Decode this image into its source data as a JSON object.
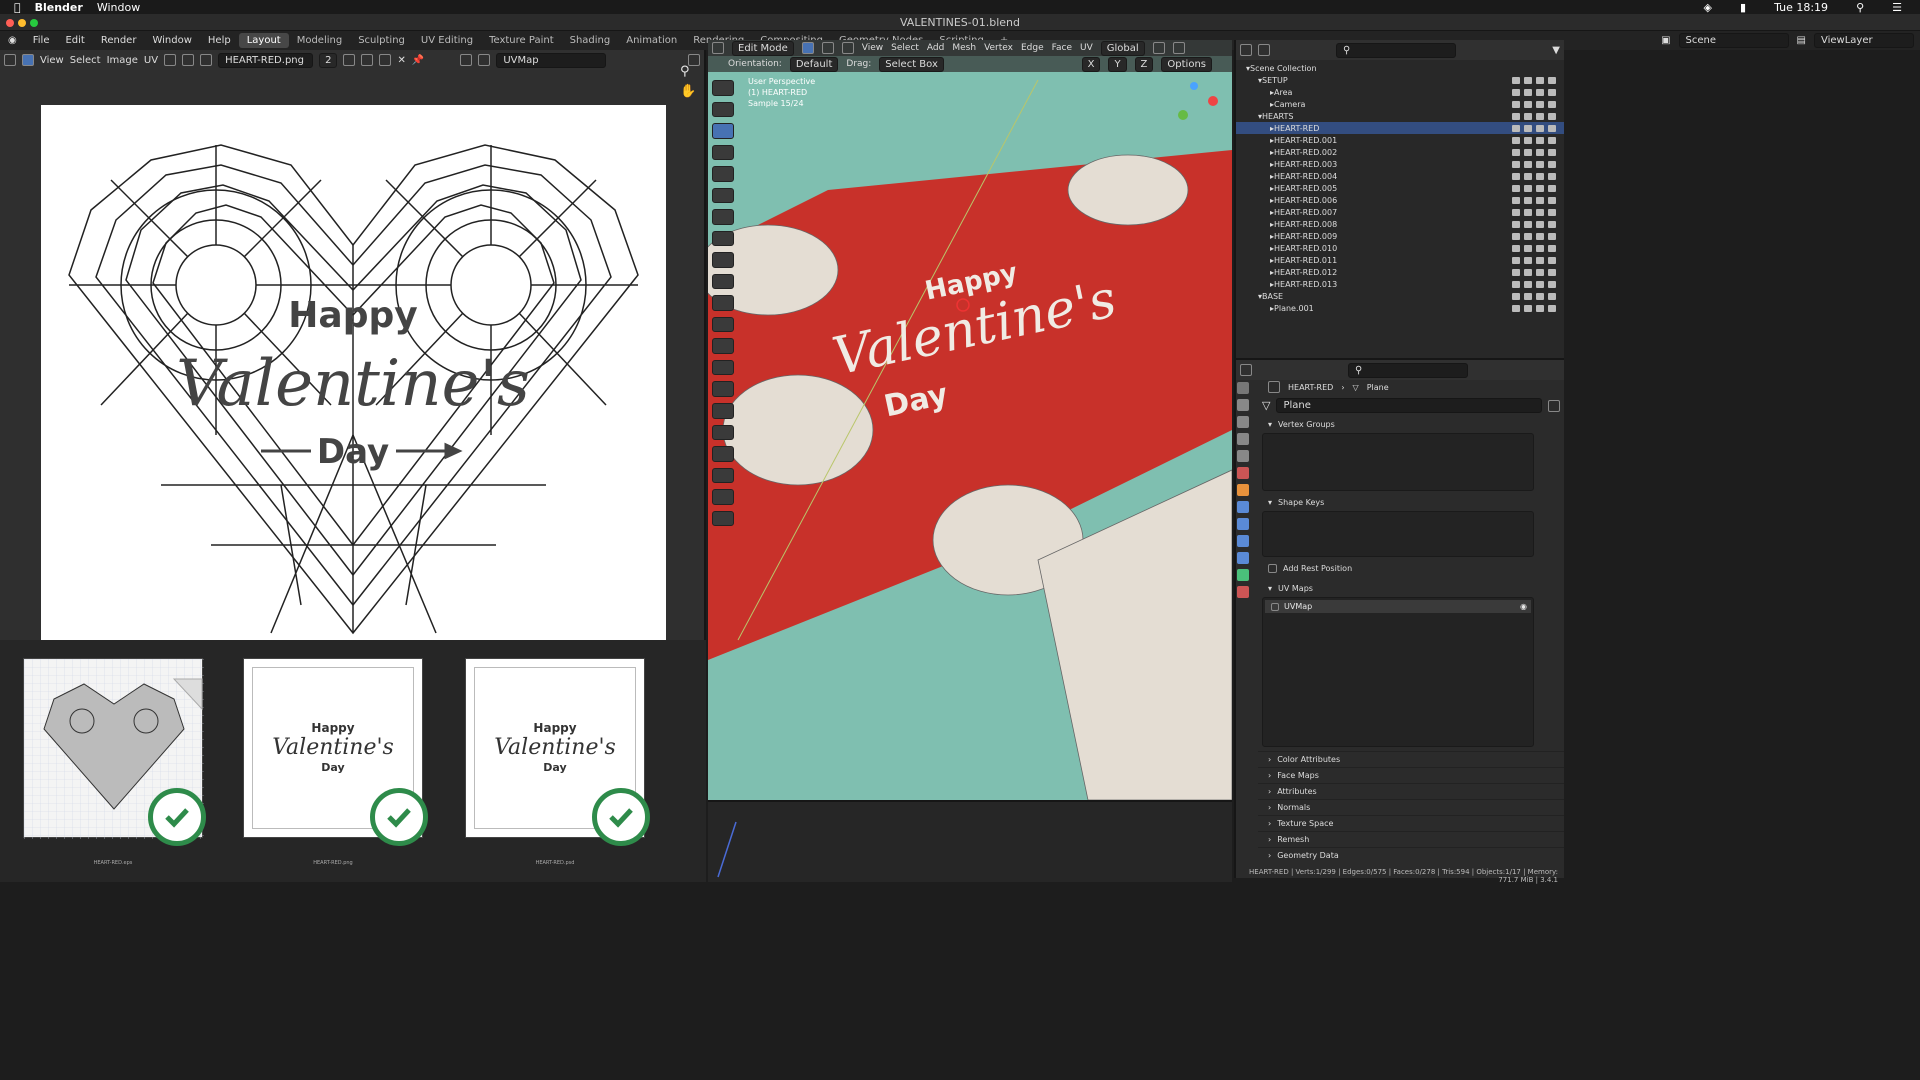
{
  "mac": {
    "app": "Blender",
    "menu": [
      "Window"
    ],
    "clock": "Tue 18:19"
  },
  "window": {
    "title": "VALENTINES-01.blend"
  },
  "topmenu": [
    "File",
    "Edit",
    "Render",
    "Window",
    "Help"
  ],
  "workspaces": [
    "Layout",
    "Modeling",
    "Sculpting",
    "UV Editing",
    "Texture Paint",
    "Shading",
    "Animation",
    "Rendering",
    "Compositing",
    "Geometry Nodes",
    "Scripting"
  ],
  "image_editor": {
    "menus": [
      "View",
      "Select",
      "Image",
      "UV"
    ],
    "image_name": "HEART-RED.png",
    "users": "2",
    "uvmap": "UVMap",
    "uv_text": {
      "line1": "Happy",
      "line2": "Valentine's",
      "line3": "Day"
    },
    "thumbs": [
      {
        "caption": "HEART-RED.eps"
      },
      {
        "caption": "HEART-RED.png"
      },
      {
        "caption": "HEART-RED.psd"
      }
    ]
  },
  "viewport": {
    "mode": "Edit Mode",
    "menus": [
      "View",
      "Select",
      "Add",
      "Mesh",
      "Vertex",
      "Edge",
      "Face",
      "UV"
    ],
    "transform": "Global",
    "orientation_label": "Orientation:",
    "orientation": "Default",
    "drag_label": "Drag:",
    "drag": "Select Box",
    "options": "Options",
    "info_perspective": "User Perspective",
    "info_object": "(1) HEART-RED",
    "info_sample": "Sample 15/24",
    "axes": [
      "X",
      "Y",
      "Z"
    ]
  },
  "outliner": {
    "scene": "Scene",
    "viewlayer": "ViewLayer",
    "items": [
      {
        "label": "Scene Collection",
        "indent": 0
      },
      {
        "label": "SETUP",
        "indent": 1
      },
      {
        "label": "Area",
        "indent": 2
      },
      {
        "label": "Camera",
        "indent": 2
      },
      {
        "label": "HEARTS",
        "indent": 1
      },
      {
        "label": "HEART-RED",
        "indent": 2,
        "selected": true
      },
      {
        "label": "HEART-RED.001",
        "indent": 2
      },
      {
        "label": "HEART-RED.002",
        "indent": 2
      },
      {
        "label": "HEART-RED.003",
        "indent": 2
      },
      {
        "label": "HEART-RED.004",
        "indent": 2
      },
      {
        "label": "HEART-RED.005",
        "indent": 2
      },
      {
        "label": "HEART-RED.006",
        "indent": 2
      },
      {
        "label": "HEART-RED.007",
        "indent": 2
      },
      {
        "label": "HEART-RED.008",
        "indent": 2
      },
      {
        "label": "HEART-RED.009",
        "indent": 2
      },
      {
        "label": "HEART-RED.010",
        "indent": 2
      },
      {
        "label": "HEART-RED.011",
        "indent": 2
      },
      {
        "label": "HEART-RED.012",
        "indent": 2
      },
      {
        "label": "HEART-RED.013",
        "indent": 2
      },
      {
        "label": "BASE",
        "indent": 1
      },
      {
        "label": "Plane.001",
        "indent": 2
      }
    ]
  },
  "properties": {
    "breadcrumb_object": "HEART-RED",
    "breadcrumb_mesh": "Plane",
    "mesh_name": "Plane",
    "sections": {
      "vertex_groups": "Vertex Groups",
      "shape_keys": "Shape Keys",
      "add_rest": "Add Rest Position",
      "uv_maps": "UV Maps",
      "uv_map_item": "UVMap"
    },
    "collapsed": [
      "Color Attributes",
      "Face Maps",
      "Attributes",
      "Normals",
      "Texture Space",
      "Remesh",
      "Geometry Data"
    ]
  },
  "status": "HEART-RED | Verts:1/299 | Edges:0/575 | Faces:0/278 | Tris:594 | Objects:1/17 | Memory: 771.7 MiB | 3.4.1",
  "colors": {
    "accent": "#4772b3",
    "green": "#2e8b4a",
    "heart_red": "#c8312a",
    "floor": "#7fbfb0"
  }
}
